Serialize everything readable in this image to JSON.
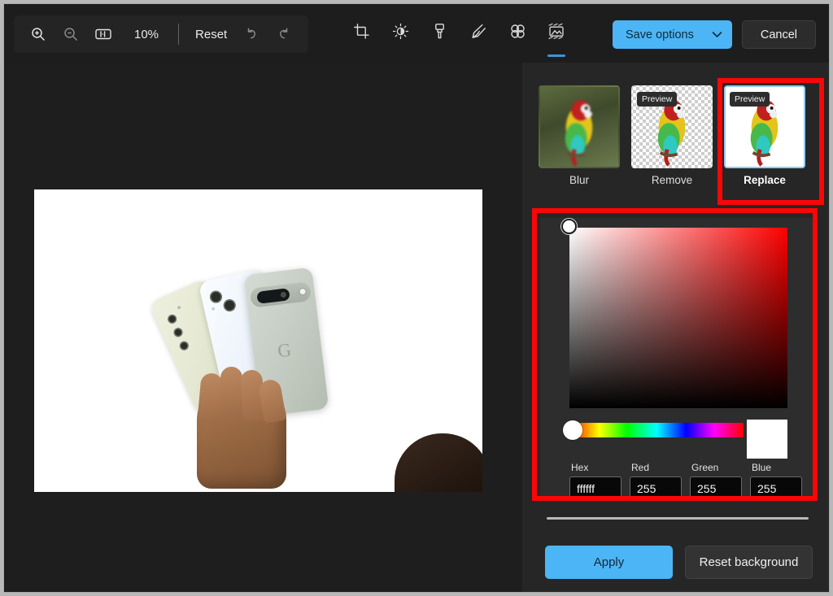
{
  "toolbar": {
    "zoom_in_icon": "zoom-in-icon",
    "zoom_out_icon": "zoom-out-icon",
    "fit_icon": "fit-to-screen-icon",
    "zoom_level": "10%",
    "reset_label": "Reset",
    "undo_icon": "undo-icon",
    "redo_icon": "redo-icon",
    "tools": [
      {
        "name": "crop",
        "icon": "crop-icon",
        "active": false
      },
      {
        "name": "adjust",
        "icon": "brightness-icon",
        "active": false
      },
      {
        "name": "marker",
        "icon": "marker-icon",
        "active": false
      },
      {
        "name": "pen",
        "icon": "pen-icon",
        "active": false
      },
      {
        "name": "blur",
        "icon": "blur-icon",
        "active": false
      },
      {
        "name": "background",
        "icon": "background-icon",
        "active": true
      }
    ],
    "save_label": "Save options",
    "save_chevron_icon": "chevron-down-icon",
    "cancel_label": "Cancel"
  },
  "canvas": {
    "image_alt": "Hand holding three smartphones on a white background",
    "background_color": "#ffffff"
  },
  "panel": {
    "background_options": [
      {
        "label": "Blur",
        "preview_badge": "",
        "selected": false
      },
      {
        "label": "Remove",
        "preview_badge": "Preview",
        "selected": false
      },
      {
        "label": "Replace",
        "preview_badge": "Preview",
        "selected": true
      }
    ],
    "color_picker": {
      "hue_degrees": 0,
      "selected_color": "#ffffff",
      "fields": [
        {
          "label": "Hex",
          "value": "ffffff",
          "name": "hex"
        },
        {
          "label": "Red",
          "value": "255",
          "name": "red"
        },
        {
          "label": "Green",
          "value": "255",
          "name": "green"
        },
        {
          "label": "Blue",
          "value": "255",
          "name": "blue"
        }
      ]
    },
    "apply_label": "Apply",
    "reset_background_label": "Reset background"
  },
  "annotations": {
    "highlight_color": "#fb0606",
    "boxes": [
      "replace-option",
      "color-picker"
    ]
  }
}
